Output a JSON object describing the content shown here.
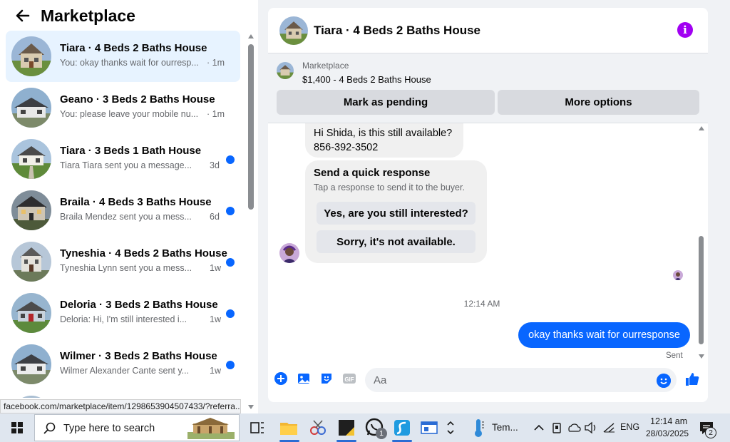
{
  "header": {
    "title": "Marketplace"
  },
  "conversations": [
    {
      "name": "Tiara · 4 Beds 2 Baths House",
      "preview": "You: okay thanks wait for ourresp...",
      "time": "· 1m",
      "unread": false,
      "active": true
    },
    {
      "name": "Geano · 3 Beds 2 Baths House",
      "preview": "You: please leave your mobile nu...",
      "time": "· 1m",
      "unread": false,
      "active": false
    },
    {
      "name": "Tiara · 3 Beds 1 Bath House",
      "preview": "Tiara Tiara sent you a message...",
      "time": "3d",
      "unread": true,
      "active": false
    },
    {
      "name": "Braila · 4 Beds 3 Baths House",
      "preview": "Braila Mendez sent you a mess...",
      "time": "6d",
      "unread": true,
      "active": false
    },
    {
      "name": "Tyneshia · 4 Beds 2 Baths House",
      "preview": "Tyneshia Lynn sent you a mess...",
      "time": "1w",
      "unread": true,
      "active": false
    },
    {
      "name": "Deloria · 3 Beds 2 Baths House",
      "preview": "Deloria: Hi, I'm still interested i...",
      "time": "1w",
      "unread": true,
      "active": false
    },
    {
      "name": "Wilmer · 3 Beds 2 Baths House",
      "preview": "Wilmer Alexander Cante sent y...",
      "time": "1w",
      "unread": true,
      "active": false
    }
  ],
  "status_url": "facebook.com/marketplace/item/1298653904507433/?referra...",
  "chat": {
    "title": "Tiara · 4 Beds 2 Baths House",
    "marketplace_label": "Marketplace",
    "listing": "$1,400 - 4 Beds 2 Baths House",
    "mark_pending_label": "Mark as pending",
    "more_options_label": "More options",
    "incoming_line1": "Hi Shida, is this still available?",
    "incoming_line2": "856-392-3502",
    "quick_response_title": "Send a quick response",
    "quick_response_sub": "Tap a response to send it to the buyer.",
    "quick_yes": "Yes, are you still interested?",
    "quick_no": "Sorry, it's not available.",
    "timestamp": "12:14 AM",
    "outgoing": "okay thanks wait for ourresponse",
    "sent_label": "Sent",
    "composer_placeholder": "Aa"
  },
  "taskbar": {
    "search_placeholder": "Type here to search",
    "whatsapp_badge": "1",
    "weather_text": "Tem...",
    "language": "ENG",
    "clock_time": "12:14 am",
    "clock_date": "28/03/2025",
    "notification_badge": "2"
  },
  "colors": {
    "accent": "#0866ff",
    "info": "#a100f2",
    "active_row": "#e7f3ff",
    "button_gray": "#d8dadf"
  }
}
